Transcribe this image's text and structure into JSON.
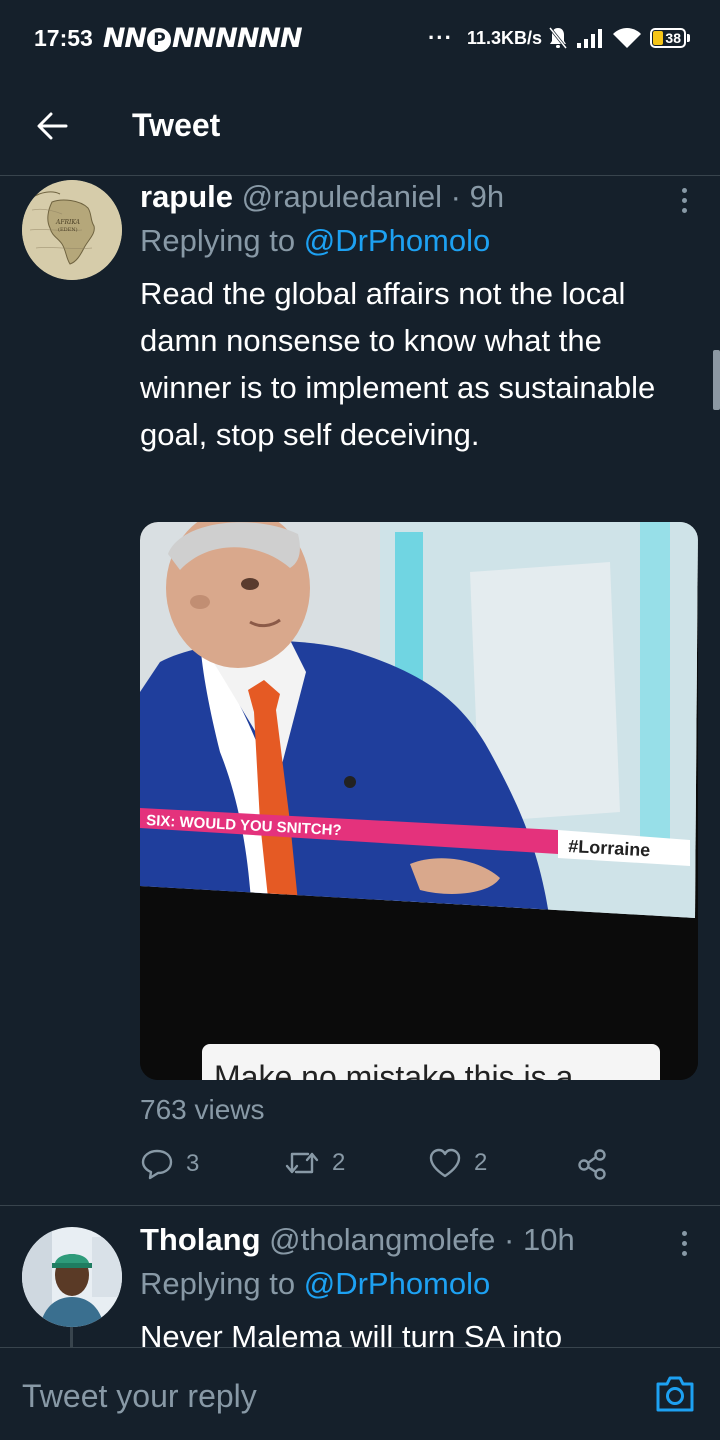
{
  "status_bar": {
    "time": "17:53",
    "notifications": "NN",
    "notifications_2": "NNNNNN",
    "badge": "P",
    "dots": "···",
    "speed": "11.3KB/s",
    "battery": "38"
  },
  "header": {
    "title": "Tweet"
  },
  "tweets": [
    {
      "name": "rapule",
      "handle": "@rapuledaniel",
      "separator": "·",
      "time": "9h",
      "replying_prefix": "Replying to",
      "replying_to": "@DrPhomolo",
      "text": "Read the global affairs not the local damn nonsense to know what the winner is to implement as sustainable goal, stop self deceiving.",
      "avatar_lettering": "AFRIKA",
      "media": {
        "banner_text": "SIX: WOULD YOU SNITCH?",
        "hashtag": "#Lorraine",
        "caption": "Make no mistake this is a"
      },
      "views": "763 views",
      "reply_count": "3",
      "retweet_count": "2",
      "like_count": "2"
    },
    {
      "name": "Tholang",
      "handle": "@tholangmolefe",
      "separator": "·",
      "time": "10h",
      "replying_prefix": "Replying to",
      "replying_to": "@DrPhomolo",
      "text": "Never Malema will turn SA into"
    }
  ],
  "reply_bar": {
    "placeholder": "Tweet your reply"
  },
  "colors": {
    "background": "#15202b",
    "accent": "#1da1f2",
    "secondary_text": "#8899a6",
    "divider": "#38444d"
  }
}
